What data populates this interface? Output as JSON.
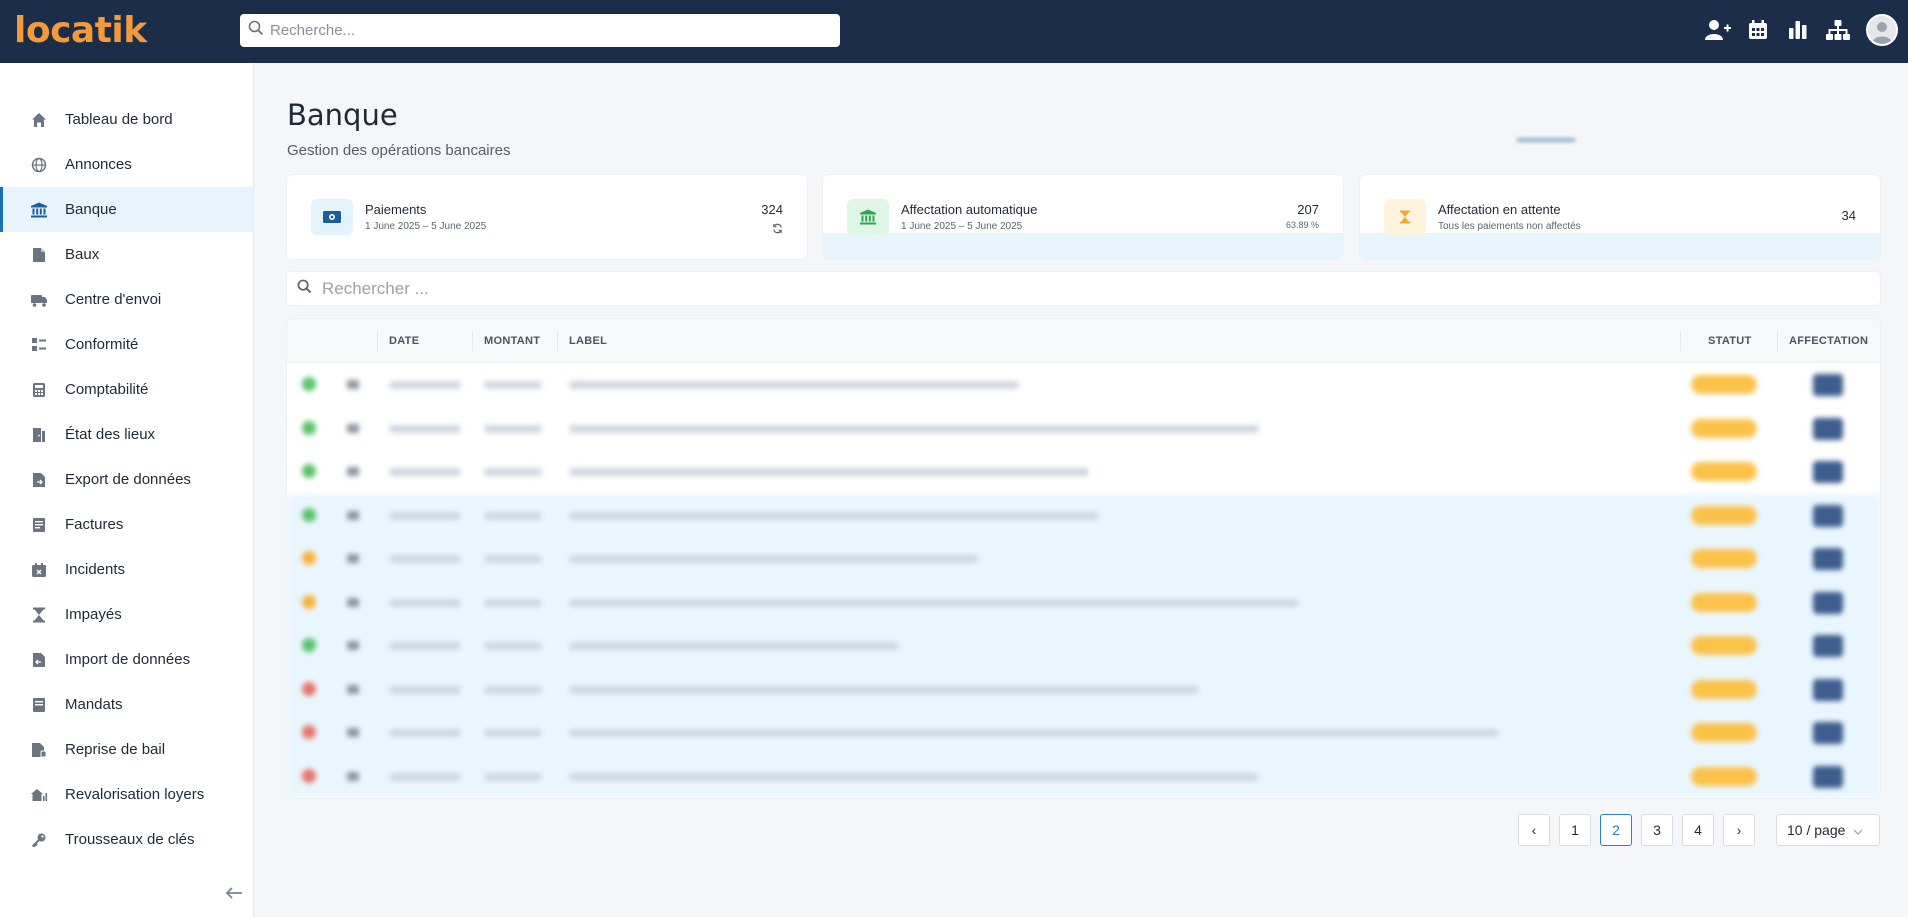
{
  "app": {
    "logo": "locatik"
  },
  "topbar": {
    "search_placeholder": "Recherche...",
    "icons": [
      "user-plus-icon",
      "calendar-icon",
      "bar-chart-icon",
      "sitemap-icon",
      "avatar"
    ]
  },
  "sidebar": {
    "active": "Banque",
    "items": [
      {
        "label": "Tableau de bord",
        "icon": "home-icon"
      },
      {
        "label": "Annonces",
        "icon": "globe-icon"
      },
      {
        "label": "Banque",
        "icon": "bank-icon"
      },
      {
        "label": "Baux",
        "icon": "file-icon"
      },
      {
        "label": "Centre d'envoi",
        "icon": "mail-truck-icon"
      },
      {
        "label": "Conformité",
        "icon": "checklist-icon"
      },
      {
        "label": "Comptabilité",
        "icon": "calculator-icon"
      },
      {
        "label": "État des lieux",
        "icon": "door-icon"
      },
      {
        "label": "Export de données",
        "icon": "file-export-icon"
      },
      {
        "label": "Factures",
        "icon": "invoice-icon"
      },
      {
        "label": "Incidents",
        "icon": "calendar-x-icon"
      },
      {
        "label": "Impayés",
        "icon": "hourglass-icon"
      },
      {
        "label": "Import de données",
        "icon": "file-import-icon"
      },
      {
        "label": "Mandats",
        "icon": "folder-icon"
      },
      {
        "label": "Reprise de bail",
        "icon": "file-sign-icon"
      },
      {
        "label": "Revalorisation loyers",
        "icon": "home-chart-icon"
      },
      {
        "label": "Trousseaux de clés",
        "icon": "key-icon"
      }
    ]
  },
  "page": {
    "title": "Banque",
    "subtitle": "Gestion des opérations bancaires"
  },
  "cards": [
    {
      "title": "Paiements",
      "subtitle": "1 June 2025 – 5 June 2025",
      "value": "324",
      "extra": "",
      "color": "#e3f2fb",
      "icon": "money-icon"
    },
    {
      "title": "Affectation automatique",
      "subtitle": "1 June 2025 – 5 June 2025",
      "value": "207",
      "extra": "63.89 %",
      "color": "#dff5e6",
      "icon": "bank-icon"
    },
    {
      "title": "Affectation en attente",
      "subtitle": "Tous les paiements non affectés",
      "value": "34",
      "extra": "",
      "color": "#fff3dd",
      "icon": "hourglass-icon"
    }
  ],
  "list_search": {
    "placeholder": "Rechercher ..."
  },
  "table": {
    "columns": {
      "date": "DATE",
      "montant": "MONTANT",
      "label": "LABEL",
      "statut": "STATUT",
      "affectation": "AFFECTATION"
    },
    "row_status_colors": [
      "#58c26a",
      "#58c26a",
      "#58c26a",
      "#58c26a",
      "#f8b23a",
      "#f8b23a",
      "#58c26a",
      "#e8746a",
      "#e8746a",
      "#e8746a"
    ],
    "row_highlight": [
      false,
      false,
      false,
      true,
      true,
      true,
      true,
      true,
      true,
      true
    ]
  },
  "pagination": {
    "prev": "‹",
    "pages": [
      "1",
      "2",
      "3",
      "4"
    ],
    "active_page": "2",
    "next": "›",
    "page_size": "10 / page"
  },
  "colors": {
    "topbar": "#1b2d48",
    "brand": "#f39a3d",
    "accent": "#2f7fc1",
    "status_pill": "#fbc24a",
    "action_button": "#3d5d8f"
  }
}
